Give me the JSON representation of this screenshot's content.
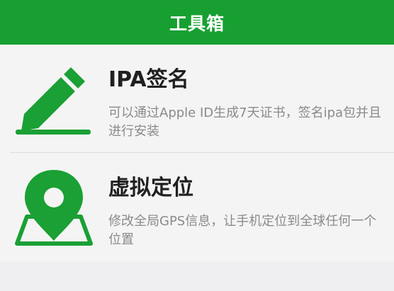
{
  "header": {
    "title": "工具箱"
  },
  "colors": {
    "brand": "#17a031",
    "icon": "#1aa034"
  },
  "tools": [
    {
      "icon": "pencil-sign-icon",
      "title": "IPA签名",
      "description": "可以通过Apple ID生成7天证书，签名ipa包并且进行安装"
    },
    {
      "icon": "map-pin-icon",
      "title": "虚拟定位",
      "description": "修改全局GPS信息，让手机定位到全球任何一个位置"
    }
  ]
}
